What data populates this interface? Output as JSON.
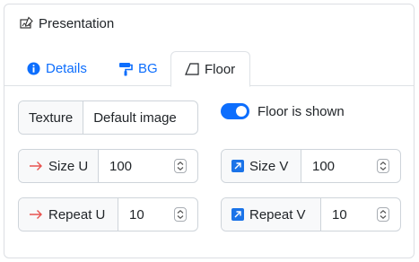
{
  "header": {
    "title": "Presentation",
    "icon": "presentation-edit-icon"
  },
  "tabs": [
    {
      "label": "Details",
      "icon": "info-circle-icon",
      "active": false
    },
    {
      "label": "BG",
      "icon": "paint-roller-icon",
      "active": false
    },
    {
      "label": "Floor",
      "icon": "floor-plane-icon",
      "active": true
    }
  ],
  "texture": {
    "label": "Texture",
    "value": "Default image"
  },
  "floor_toggle": {
    "label": "Floor is shown",
    "on": true
  },
  "fields": {
    "size_u": {
      "label": "Size U",
      "value": "100",
      "icon": "arrow-right-icon"
    },
    "size_v": {
      "label": "Size V",
      "value": "100",
      "icon": "arrow-up-right-box-icon"
    },
    "repeat_u": {
      "label": "Repeat U",
      "value": "10",
      "icon": "arrow-right-icon"
    },
    "repeat_v": {
      "label": "Repeat V",
      "value": "10",
      "icon": "arrow-up-right-box-icon"
    }
  },
  "colors": {
    "accent": "#0d6efd",
    "u_arrow": "#e8534f",
    "v_box": "#1a73e8"
  }
}
